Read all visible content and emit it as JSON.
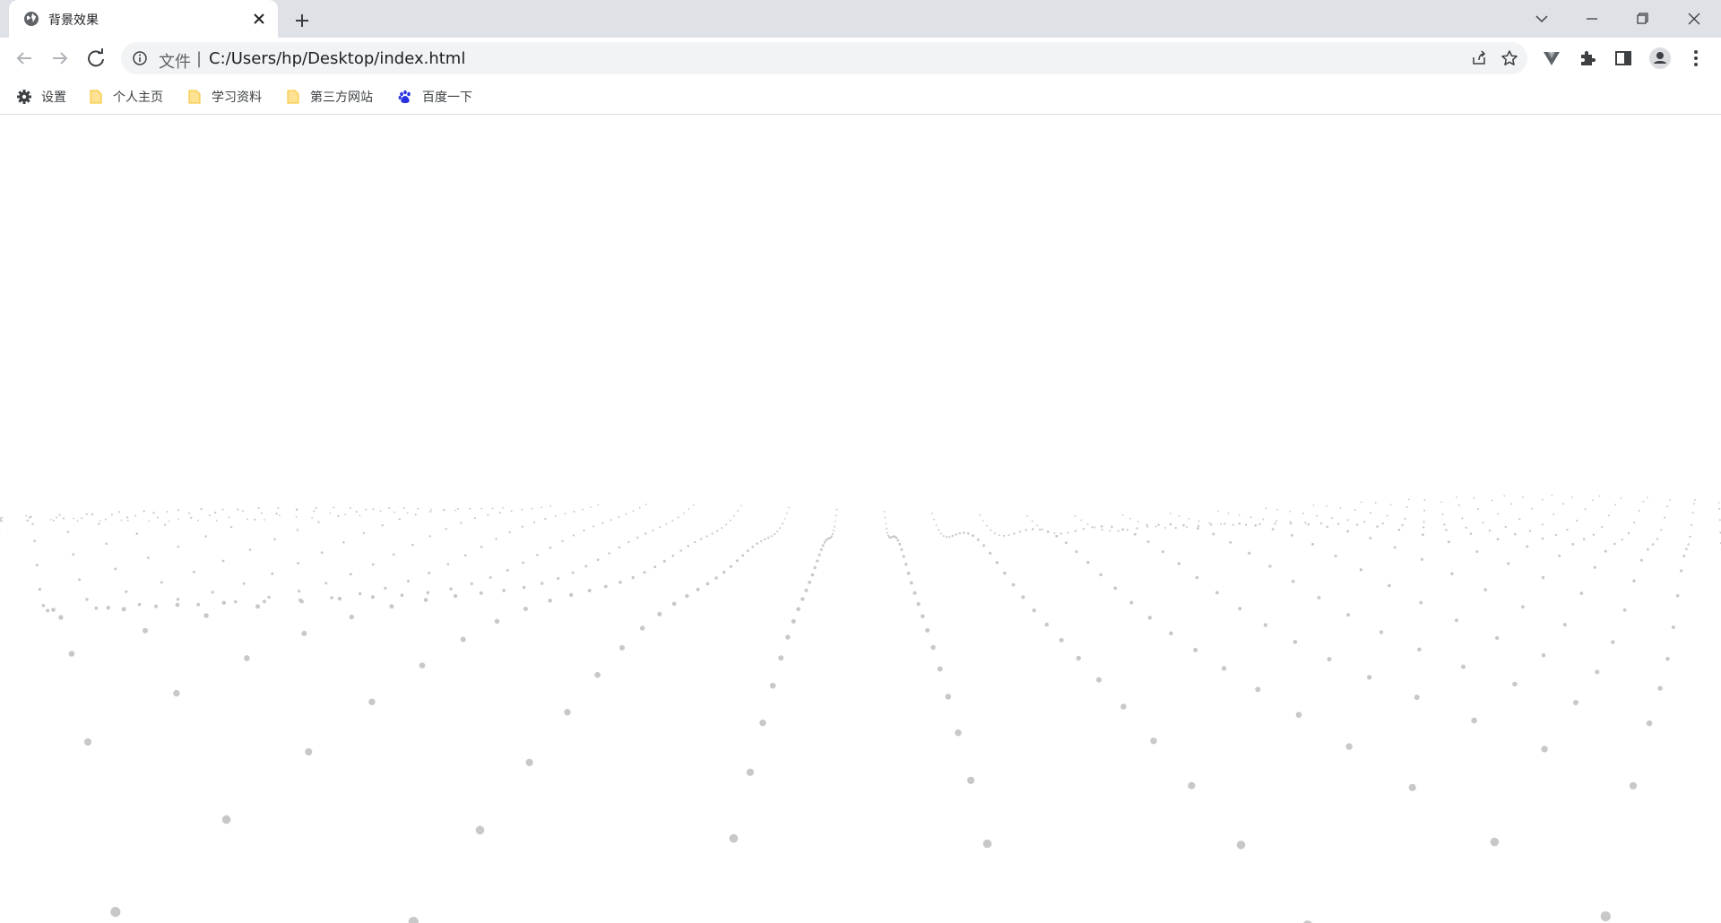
{
  "browser": {
    "tab": {
      "title": "背景效果",
      "favicon": "globe-icon"
    },
    "new_tab_icon": "plus-icon",
    "window_controls": [
      "chevron-down-icon",
      "minimize-icon",
      "restore-icon",
      "close-icon"
    ],
    "nav_icons": [
      "back-arrow-icon",
      "forward-arrow-icon",
      "reload-icon"
    ],
    "address_bar": {
      "scheme_label": "文件",
      "separator": "|",
      "url": "C:/Users/hp/Desktop/index.html"
    },
    "toolbar_icons": [
      "share-icon",
      "star-icon",
      "vue-devtools-icon",
      "extensions-icon",
      "side-panel-icon",
      "profile-icon",
      "menu-icon"
    ]
  },
  "bookmarks": [
    {
      "label": "设置",
      "icon": "gear-icon"
    },
    {
      "label": "个人主页",
      "icon": "folder-icon"
    },
    {
      "label": "学习资料",
      "icon": "folder-icon"
    },
    {
      "label": "第三方网站",
      "icon": "folder-icon"
    },
    {
      "label": "百度一下",
      "icon": "baidu-paw-icon"
    }
  ],
  "page": {
    "effect": "3D particle wave field",
    "particle_color": "#c8c8c8",
    "background_color": "#ffffff"
  }
}
